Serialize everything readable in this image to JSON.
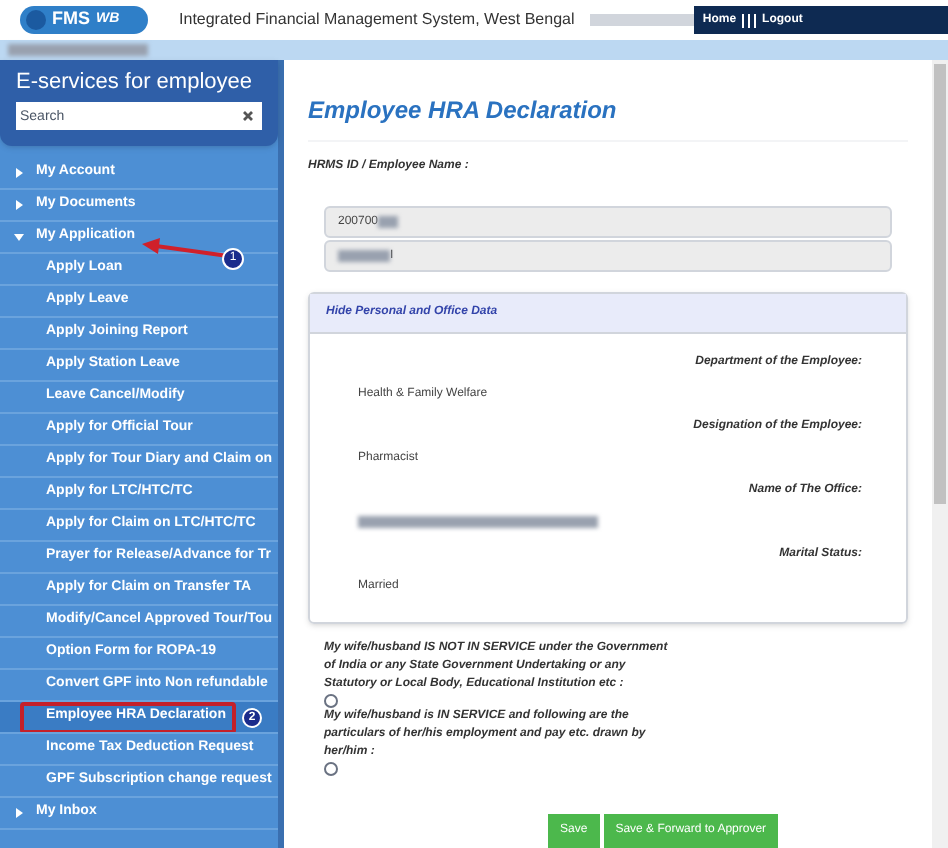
{
  "header": {
    "logo": "FMS",
    "logo_sub": "WB",
    "title": "Integrated Financial Management System, West Bengal",
    "links": [
      "Home",
      "Logout"
    ]
  },
  "sidebar": {
    "title": "E-services for employee",
    "search": {
      "placeholder": "Search"
    },
    "items": [
      {
        "label": "My Account",
        "expanded": false
      },
      {
        "label": "My Documents",
        "expanded": false
      },
      {
        "label": "My Application",
        "expanded": true,
        "children": [
          {
            "label": "Apply Loan",
            "selected": false
          },
          {
            "label": "Apply Leave",
            "selected": false
          },
          {
            "label": "Apply Joining Report",
            "selected": false
          },
          {
            "label": "Apply Station Leave",
            "selected": false
          },
          {
            "label": "Leave Cancel/Modify",
            "selected": false
          },
          {
            "label": "Apply for Official Tour",
            "selected": false
          },
          {
            "label": "Apply for Tour Diary and Claim on",
            "selected": false
          },
          {
            "label": "Apply for LTC/HTC/TC",
            "selected": false
          },
          {
            "label": "Apply for Claim on LTC/HTC/TC",
            "selected": false
          },
          {
            "label": "Prayer for Release/Advance for Tr",
            "selected": false
          },
          {
            "label": "Apply for Claim on Transfer TA",
            "selected": false
          },
          {
            "label": "Modify/Cancel Approved Tour/Tou",
            "selected": false
          },
          {
            "label": "Option Form for ROPA-19",
            "selected": false
          },
          {
            "label": "Convert GPF into Non refundable",
            "selected": false
          },
          {
            "label": "Employee HRA Declaration",
            "selected": true
          },
          {
            "label": "Income Tax Deduction Request",
            "selected": false
          },
          {
            "label": "GPF Subscription change request",
            "selected": false
          }
        ]
      },
      {
        "label": "My Inbox",
        "expanded": false
      }
    ]
  },
  "annotations": [
    "1",
    "2"
  ],
  "main": {
    "title": "Employee HRA Declaration",
    "hrms_label": "HRMS ID / Employee Name :",
    "fields": [
      "200700",
      "I"
    ],
    "panel": {
      "header": "Hide Personal and Office Data",
      "rows": [
        {
          "label": "Department of the Employee:",
          "value": "Health & Family Welfare"
        },
        {
          "label": "Designation of the Employee:",
          "value": "Pharmacist"
        },
        {
          "label": "Name of The Office:"
        },
        {
          "label": "Marital Status:",
          "value": "Married"
        }
      ]
    },
    "options": [
      {
        "text": "My wife/husband IS NOT IN SERVICE under the Government of India or any State Government Undertaking or any Statutory or Local Body, Educational Institution etc :",
        "selected": false
      },
      {
        "text": "My wife/husband is IN SERVICE and following are the particulars of her/his employment and pay etc. drawn by her/him :",
        "selected": false
      }
    ],
    "buttons": [
      "Save",
      "Save & Forward to Approver"
    ]
  }
}
